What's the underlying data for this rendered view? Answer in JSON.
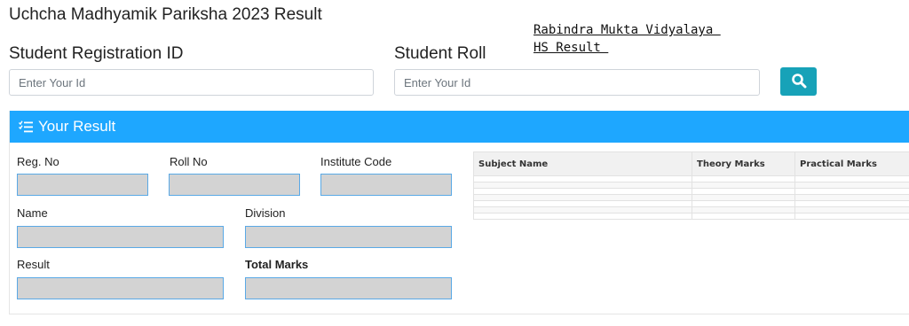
{
  "page": {
    "title": "Uchcha Madhyamik Pariksha 2023 Result",
    "school_link_line1": "Rabindra Mukta Vidyalaya ",
    "school_link_line2": "HS Result "
  },
  "search": {
    "reg_label": "Student Registration ID",
    "reg_placeholder": "Enter Your Id",
    "roll_label": "Student Roll",
    "roll_placeholder": "Enter Your Id",
    "button_icon": "search-icon"
  },
  "result_panel": {
    "header_icon": "list-check-icon",
    "header_title": "Your Result",
    "fields": {
      "reg_no": "Reg. No",
      "roll_no": "Roll No",
      "institute_code": "Institute Code",
      "name": "Name",
      "division": "Division",
      "result": "Result",
      "total_marks": "Total Marks"
    },
    "values": {
      "reg_no": "",
      "roll_no": "",
      "institute_code": "",
      "name": "",
      "division": "",
      "result": "",
      "total_marks": ""
    }
  },
  "marks_table": {
    "columns": [
      "Subject Name",
      "Theory Marks",
      "Practical Marks"
    ],
    "rows": [
      [
        "",
        "",
        ""
      ],
      [
        "",
        "",
        ""
      ],
      [
        "",
        "",
        ""
      ],
      [
        "",
        "",
        ""
      ],
      [
        "",
        "",
        ""
      ],
      [
        "",
        "",
        ""
      ],
      [
        "",
        "",
        ""
      ]
    ]
  },
  "colors": {
    "header_bg": "#1ea7ff",
    "search_button_bg": "#17a2b8",
    "field_bg": "#d3d3d3",
    "field_border": "#5aa9e6"
  }
}
